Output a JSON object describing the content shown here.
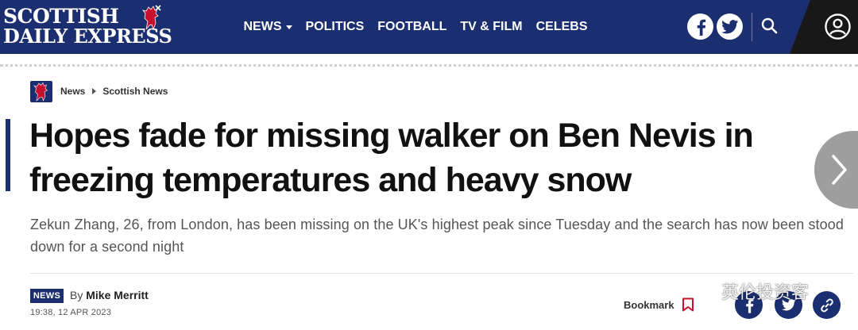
{
  "header": {
    "logo_line1": "SCOTTISH",
    "logo_line2": "DAILY EXPRESS",
    "nav": [
      {
        "label": "NEWS",
        "has_dropdown": true
      },
      {
        "label": "POLITICS"
      },
      {
        "label": "FOOTBALL"
      },
      {
        "label": "TV & FILM"
      },
      {
        "label": "CELEBS"
      }
    ],
    "icons": [
      "facebook-icon",
      "twitter-icon",
      "search-icon",
      "account-icon"
    ],
    "colors": {
      "brand_navy": "#1b2e6f",
      "account_bg": "#181818"
    }
  },
  "breadcrumb": {
    "items": [
      "News",
      "Scottish News"
    ]
  },
  "article": {
    "headline": "Hopes fade for missing walker on Ben Nevis in freezing temperatures and heavy snow",
    "standfirst": "Zekun Zhang, 26, from London, has been missing on the UK's highest peak since Tuesday and the search has now been stood down for a second night",
    "badge": "NEWS",
    "by_prefix": "By",
    "author": "Mike Merritt",
    "timestamp": "19:38, 12 APR 2023",
    "bookmark_label": "Bookmark"
  },
  "share_icons": [
    "facebook-icon",
    "twitter-icon",
    "link-icon"
  ],
  "watermark": {
    "text": "英伦投资客",
    "icon": "wechat-icon"
  }
}
